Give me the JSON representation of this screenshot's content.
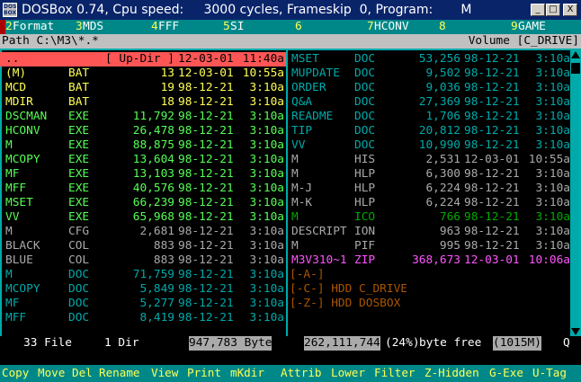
{
  "window": {
    "title": "DOSBox 0.74, Cpu speed:     3000 cycles, Frameskip  0, Program:       M",
    "icon_text": "DOS BOX",
    "minimize": "_",
    "maximize": "□",
    "close": "X"
  },
  "fkeys": [
    {
      "num": "2",
      "label": "Format"
    },
    {
      "num": "3",
      "label": "MDS"
    },
    {
      "num": "4",
      "label": "FFF"
    },
    {
      "num": "5",
      "label": "SI"
    },
    {
      "num": "6",
      "label": ""
    },
    {
      "num": "7",
      "label": "HCONV"
    },
    {
      "num": "8",
      "label": ""
    },
    {
      "num": "9",
      "label": "GAME"
    }
  ],
  "path": {
    "label": "Path C:\\M3\\*.*",
    "volume": "Volume [C_DRIVE]"
  },
  "left_panel": [
    {
      "name": "..",
      "ext": "",
      "size": "[ Up-Dir ]",
      "date": "12-03-01",
      "time": "11:40a",
      "color": "#000000",
      "selected": true
    },
    {
      "name": "(M)",
      "ext": "BAT",
      "size": "13",
      "date": "12-03-01",
      "time": "10:55a",
      "color": "#ffff55"
    },
    {
      "name": "MCD",
      "ext": "BAT",
      "size": "19",
      "date": "98-12-21",
      "time": "3:10a",
      "color": "#ffff55"
    },
    {
      "name": "MDIR",
      "ext": "BAT",
      "size": "18",
      "date": "98-12-21",
      "time": "3:10a",
      "color": "#ffff55"
    },
    {
      "name": "DSCMAN",
      "ext": "EXE",
      "size": "11,792",
      "date": "98-12-21",
      "time": "3:10a",
      "color": "#55ff55"
    },
    {
      "name": "HCONV",
      "ext": "EXE",
      "size": "26,478",
      "date": "98-12-21",
      "time": "3:10a",
      "color": "#55ff55"
    },
    {
      "name": "M",
      "ext": "EXE",
      "size": "88,875",
      "date": "98-12-21",
      "time": "3:10a",
      "color": "#55ff55"
    },
    {
      "name": "MCOPY",
      "ext": "EXE",
      "size": "13,604",
      "date": "98-12-21",
      "time": "3:10a",
      "color": "#55ff55"
    },
    {
      "name": "MF",
      "ext": "EXE",
      "size": "13,103",
      "date": "98-12-21",
      "time": "3:10a",
      "color": "#55ff55"
    },
    {
      "name": "MFF",
      "ext": "EXE",
      "size": "40,576",
      "date": "98-12-21",
      "time": "3:10a",
      "color": "#55ff55"
    },
    {
      "name": "MSET",
      "ext": "EXE",
      "size": "66,239",
      "date": "98-12-21",
      "time": "3:10a",
      "color": "#55ff55"
    },
    {
      "name": "VV",
      "ext": "EXE",
      "size": "65,968",
      "date": "98-12-21",
      "time": "3:10a",
      "color": "#55ff55"
    },
    {
      "name": "M",
      "ext": "CFG",
      "size": "2,681",
      "date": "98-12-21",
      "time": "3:10a",
      "color": "#aaaaaa"
    },
    {
      "name": "BLACK",
      "ext": "COL",
      "size": "883",
      "date": "98-12-21",
      "time": "3:10a",
      "color": "#aaaaaa"
    },
    {
      "name": "BLUE",
      "ext": "COL",
      "size": "883",
      "date": "98-12-21",
      "time": "3:10a",
      "color": "#aaaaaa"
    },
    {
      "name": "M",
      "ext": "DOC",
      "size": "71,759",
      "date": "98-12-21",
      "time": "3:10a",
      "color": "#00aaaa"
    },
    {
      "name": "MCOPY",
      "ext": "DOC",
      "size": "5,849",
      "date": "98-12-21",
      "time": "3:10a",
      "color": "#00aaaa"
    },
    {
      "name": "MF",
      "ext": "DOC",
      "size": "5,277",
      "date": "98-12-21",
      "time": "3:10a",
      "color": "#00aaaa"
    },
    {
      "name": "MFF",
      "ext": "DOC",
      "size": "8,419",
      "date": "98-12-21",
      "time": "3:10a",
      "color": "#00aaaa"
    }
  ],
  "right_panel": [
    {
      "name": "MSET",
      "ext": "DOC",
      "size": "53,256",
      "date": "98-12-21",
      "time": "3:10a",
      "color": "#00aaaa"
    },
    {
      "name": "MUPDATE",
      "ext": "DOC",
      "size": "9,502",
      "date": "98-12-21",
      "time": "3:10a",
      "color": "#00aaaa"
    },
    {
      "name": "ORDER",
      "ext": "DOC",
      "size": "9,036",
      "date": "98-12-21",
      "time": "3:10a",
      "color": "#00aaaa"
    },
    {
      "name": "Q&A",
      "ext": "DOC",
      "size": "27,369",
      "date": "98-12-21",
      "time": "3:10a",
      "color": "#00aaaa"
    },
    {
      "name": "README",
      "ext": "DOC",
      "size": "1,706",
      "date": "98-12-21",
      "time": "3:10a",
      "color": "#00aaaa"
    },
    {
      "name": "TIP",
      "ext": "DOC",
      "size": "20,812",
      "date": "98-12-21",
      "time": "3:10a",
      "color": "#00aaaa"
    },
    {
      "name": "VV",
      "ext": "DOC",
      "size": "10,990",
      "date": "98-12-21",
      "time": "3:10a",
      "color": "#00aaaa"
    },
    {
      "name": "M",
      "ext": "HIS",
      "size": "2,531",
      "date": "12-03-01",
      "time": "10:55a",
      "color": "#aaaaaa"
    },
    {
      "name": "M",
      "ext": "HLP",
      "size": "6,300",
      "date": "98-12-21",
      "time": "3:10a",
      "color": "#aaaaaa"
    },
    {
      "name": "M-J",
      "ext": "HLP",
      "size": "6,224",
      "date": "98-12-21",
      "time": "3:10a",
      "color": "#aaaaaa"
    },
    {
      "name": "M-K",
      "ext": "HLP",
      "size": "6,224",
      "date": "98-12-21",
      "time": "3:10a",
      "color": "#aaaaaa"
    },
    {
      "name": "M",
      "ext": "ICO",
      "size": "766",
      "date": "98-12-21",
      "time": "3:10a",
      "color": "#00aa00"
    },
    {
      "name": "DESCRIPT",
      "ext": "ION",
      "size": "963",
      "date": "98-12-21",
      "time": "3:10a",
      "color": "#aaaaaa"
    },
    {
      "name": "M",
      "ext": "PIF",
      "size": "995",
      "date": "98-12-21",
      "time": "3:10a",
      "color": "#aaaaaa"
    },
    {
      "name": "M3V310~1",
      "ext": "ZIP",
      "size": "368,673",
      "date": "12-03-01",
      "time": "10:06a",
      "color": "#ff55ff"
    }
  ],
  "drives": [
    "[-A-]",
    "[-C-] HDD C_DRIVE",
    "[-Z-] HDD DOSBOX"
  ],
  "status": {
    "files": "33 File",
    "dirs": "1 Dir",
    "bytes": "947,783 Byte",
    "free_a": "262,111,744",
    "free_pct": "(24%)",
    "free_b": "byte free",
    "free_mb": "(1015M)",
    "q": "Q"
  },
  "commands": [
    "Copy",
    "Move",
    "Del",
    "Rename",
    "View",
    "Print",
    "mKdir",
    "Attrib",
    "Lower",
    "Filter",
    "Z-Hidden",
    "G-Exe",
    "U-Tag"
  ],
  "colors": {
    "selected_bg": "#ff5555",
    "border": "#00aaaa",
    "fkey_bg": "#008888",
    "cmd_text": "#ffff55"
  }
}
